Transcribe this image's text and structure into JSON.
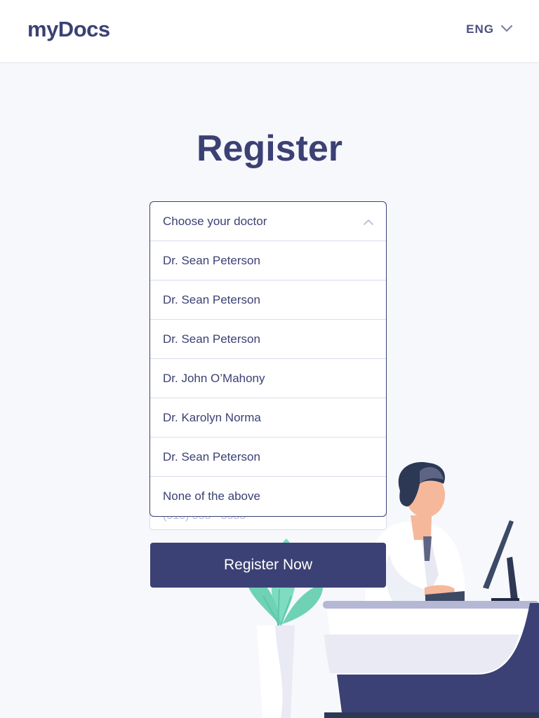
{
  "header": {
    "logo": "myDocs",
    "language": "ENG"
  },
  "page": {
    "title": "Register"
  },
  "doctor_select": {
    "placeholder": "Choose your doctor",
    "options": [
      "Dr. Sean Peterson",
      "Dr. Sean Peterson",
      "Dr. Sean Peterson",
      "Dr. John O’Mahony",
      "Dr. Karolyn Norma",
      "Dr. Sean Peterson",
      "None of the above"
    ]
  },
  "phone": {
    "placeholder": "(515) 555 - 5555"
  },
  "actions": {
    "register_label": "Register Now"
  },
  "colors": {
    "primary": "#3b4174",
    "background": "#f7f8fc",
    "border": "#d9dcea",
    "plant": "#7fdcc1",
    "skin": "#f6b89a"
  },
  "icons": {
    "language_chevron": "chevron-down-icon",
    "select_chevron": "chevron-up-icon"
  }
}
